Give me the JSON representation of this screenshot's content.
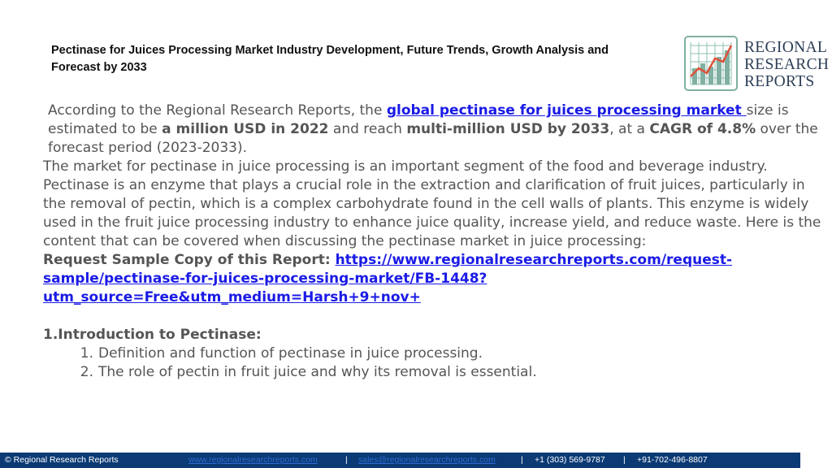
{
  "header": {
    "title": "Pectinase for Juices Processing Market Industry Development, Future Trends, Growth Analysis and Forecast  by 2033"
  },
  "logo": {
    "line1": "REGIONAL",
    "line2": "RESEARCH",
    "line3": "REPORTS",
    "icon": "line-chart-grid-icon",
    "colors": {
      "frame": "#7fb0a2",
      "line": "#e0503a",
      "text": "#2c3e55"
    }
  },
  "content": {
    "intro_prefix": "According to the Regional Research Reports, the ",
    "intro_link": "global pectinase for juices processing market ",
    "intro_mid1": "size is estimated to be ",
    "intro_bold1": "a million USD in 2022",
    "intro_mid2": " and reach ",
    "intro_bold2": "multi-million USD by 2033",
    "intro_mid3": ", at a ",
    "intro_bold3": "CAGR of 4.8%",
    "intro_suffix": " over the forecast period (2023-2033).",
    "paragraph": "The market for pectinase in juice processing is an important segment of the food and beverage industry. Pectinase is an enzyme that plays a crucial role in the extraction and clarification of fruit juices, particularly in the removal of pectin, which is a complex carbohydrate found in the cell walls of plants. This enzyme is widely used in the fruit juice processing industry to enhance juice quality, increase yield, and reduce waste. Here is the content that can be covered when discussing the pectinase market in juice processing:",
    "sample_label": "Request Sample Copy of this Report: ",
    "sample_link": "https://www.regionalresearchreports.com/request-sample/pectinase-for-juices-processing-market/FB-1448?utm_source=Free&utm_medium=Harsh+9+nov+",
    "section_title": "1.Introduction to Pectinase:",
    "items": [
      {
        "num": "1.",
        "text": "Definition and function of pectinase in juice processing."
      },
      {
        "num": "2.",
        "text": "The role of pectin in fruit juice and why its removal is essential."
      }
    ]
  },
  "footer": {
    "copyright": "© Regional Research Reports",
    "website": "www.regionalresearchreports.com",
    "sep1": "|",
    "email": "sales@regionalresearchreports.com",
    "sep2": "|",
    "phone1": "+1 (303) 569-9787",
    "sep3": "|",
    "phone2": "+91-702-496-8807",
    "bg_color": "#0b3a74"
  }
}
